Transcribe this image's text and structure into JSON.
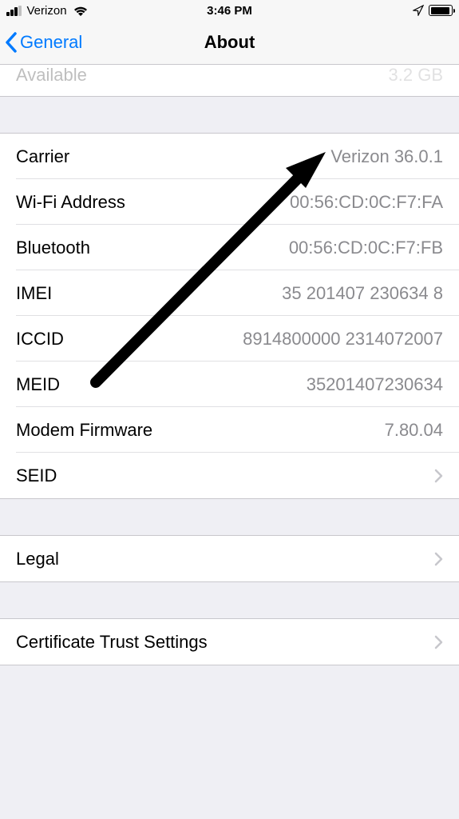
{
  "status": {
    "carrier": "Verizon",
    "time": "3:46 PM"
  },
  "nav": {
    "back_label": "General",
    "title": "About"
  },
  "partial": {
    "label": "Available",
    "value": "3.2 GB"
  },
  "rows": {
    "carrier": {
      "label": "Carrier",
      "value": "Verizon 36.0.1"
    },
    "wifi": {
      "label": "Wi-Fi Address",
      "value": "00:56:CD:0C:F7:FA"
    },
    "bluetooth": {
      "label": "Bluetooth",
      "value": "00:56:CD:0C:F7:FB"
    },
    "imei": {
      "label": "IMEI",
      "value": "35 201407 230634 8"
    },
    "iccid": {
      "label": "ICCID",
      "value": "8914800000 2314072007"
    },
    "meid": {
      "label": "MEID",
      "value": "35201407230634"
    },
    "modem": {
      "label": "Modem Firmware",
      "value": "7.80.04"
    },
    "seid": {
      "label": "SEID"
    }
  },
  "legal": {
    "label": "Legal"
  },
  "cert": {
    "label": "Certificate Trust Settings"
  }
}
